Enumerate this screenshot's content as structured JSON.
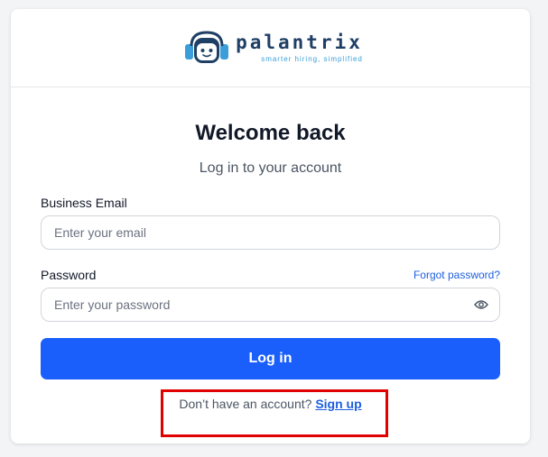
{
  "brand": {
    "name": "palantrix",
    "tagline": "smarter hiring, simplified",
    "logo_icon": "palantrix-headset-face-logo",
    "primary_color": "#1a5ffb",
    "logo_dark": "#1f3f66",
    "logo_light": "#3b9ed8"
  },
  "login": {
    "title": "Welcome back",
    "subtitle": "Log in to your account",
    "email_label": "Business Email",
    "email_placeholder": "Enter your email",
    "email_value": "",
    "password_label": "Password",
    "forgot_password": "Forgot password?",
    "password_placeholder": "Enter your password",
    "password_value": "",
    "password_toggle_icon": "eye-icon",
    "submit_label": "Log in",
    "signup_prompt": "Don’t have an account?",
    "signup_link": "Sign up"
  },
  "annotation": {
    "highlight_color": "#e00000"
  }
}
